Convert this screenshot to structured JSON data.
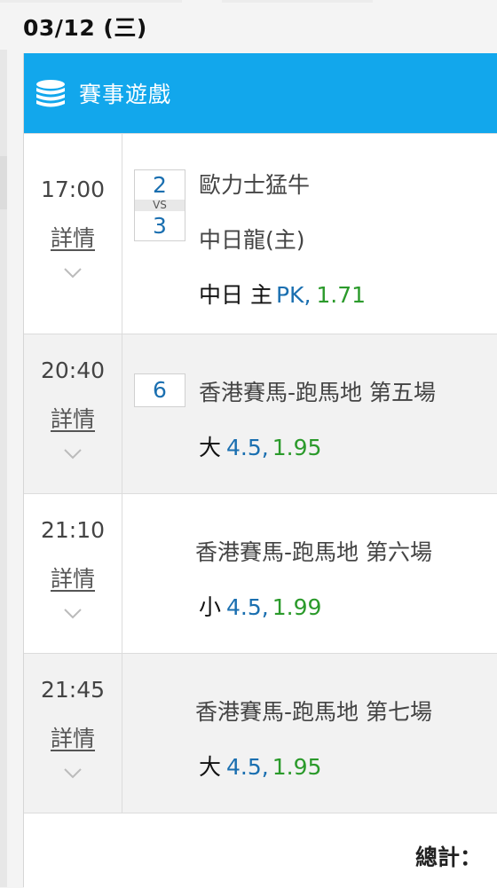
{
  "header": {
    "date": "03/12 (三)"
  },
  "panel": {
    "title": "賽事遊戲",
    "icon": "coins-icon"
  },
  "events": [
    {
      "time": "17:00",
      "detail_label": "詳情",
      "score_home": "2",
      "vs_label": "VS",
      "score_away": "3",
      "team_home": "歐力士猛牛",
      "team_away": "中日龍(主)",
      "bet_prefix": "中日 主",
      "bet_line": "PK",
      "bet_odds": "1.71"
    },
    {
      "time": "20:40",
      "detail_label": "詳情",
      "box_number": "6",
      "race": "香港賽馬-跑馬地 第五場",
      "bet_prefix": "大",
      "bet_line": "4.5",
      "bet_odds": "1.95"
    },
    {
      "time": "21:10",
      "detail_label": "詳情",
      "race": "香港賽馬-跑馬地 第六場",
      "bet_prefix": "小",
      "bet_line": "4.5",
      "bet_odds": "1.99"
    },
    {
      "time": "21:45",
      "detail_label": "詳情",
      "race": "香港賽馬-跑馬地 第七場",
      "bet_prefix": "大",
      "bet_line": "4.5",
      "bet_odds": "1.95"
    }
  ],
  "footer": {
    "total_label": "總計："
  },
  "colors": {
    "accent": "#12a7ec",
    "handicap": "#1a6fb0",
    "odds": "#2b9a2b"
  }
}
